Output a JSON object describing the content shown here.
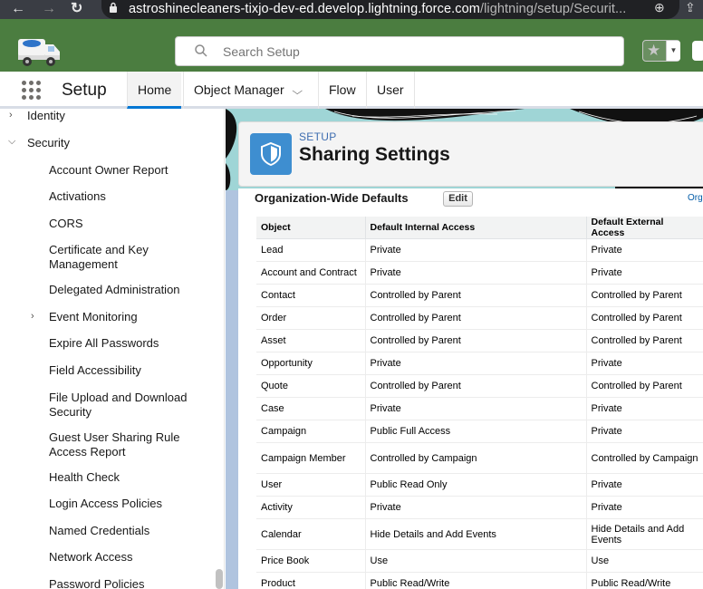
{
  "browser": {
    "back_glyph": "←",
    "forward_glyph": "→",
    "reload_glyph": "↻",
    "url_host": "astroshinecleaners-tixjo-dev-ed.develop.lightning.force.com",
    "url_path": "/lightning/setup/Securit...",
    "zoom_glyph": "⊕",
    "share_glyph": "⇪"
  },
  "header": {
    "search_placeholder": "Search Setup",
    "favorites_star": "★",
    "favorites_dropdown": "▼"
  },
  "appnav": {
    "app_name": "Setup",
    "tabs": [
      {
        "label": "Home",
        "active": true
      },
      {
        "label": "Object Manager",
        "has_menu": true
      },
      {
        "label": "Flow"
      },
      {
        "label": "User"
      }
    ],
    "chevron": "⌵"
  },
  "sidebar": {
    "items": [
      {
        "label": "Identity",
        "arrow": "›",
        "level": 0
      },
      {
        "label": "Security",
        "arrow": "⌵",
        "level": 0
      },
      {
        "label": "Account Owner Report"
      },
      {
        "label": "Activations"
      },
      {
        "label": "CORS"
      },
      {
        "label": "Certificate and Key Management"
      },
      {
        "label": "Delegated Administration"
      },
      {
        "label": "Event Monitoring",
        "arrow": "›"
      },
      {
        "label": "Expire All Passwords"
      },
      {
        "label": "Field Accessibility"
      },
      {
        "label": "File Upload and Download Security"
      },
      {
        "label": "Guest User Sharing Rule Access Report"
      },
      {
        "label": "Health Check"
      },
      {
        "label": "Login Access Policies"
      },
      {
        "label": "Named Credentials"
      },
      {
        "label": "Network Access"
      },
      {
        "label": "Password Policies"
      }
    ]
  },
  "page_header": {
    "eyebrow": "SETUP",
    "title": "Sharing Settings"
  },
  "owd": {
    "title": "Organization-Wide Defaults",
    "edit_label": "Edit",
    "org_link": "Org",
    "columns": [
      "Object",
      "Default Internal Access",
      "Default External Access"
    ],
    "rows": [
      [
        "Lead",
        "Private",
        "Private"
      ],
      [
        "Account and Contract",
        "Private",
        "Private"
      ],
      [
        "Contact",
        "Controlled by Parent",
        "Controlled by Parent"
      ],
      [
        "Order",
        "Controlled by Parent",
        "Controlled by Parent"
      ],
      [
        "Asset",
        "Controlled by Parent",
        "Controlled by Parent"
      ],
      [
        "Opportunity",
        "Private",
        "Private"
      ],
      [
        "Quote",
        "Controlled by Parent",
        "Controlled by Parent"
      ],
      [
        "Case",
        "Private",
        "Private"
      ],
      [
        "Campaign",
        "Public Full Access",
        "Private"
      ],
      [
        "Campaign Member",
        "Controlled by Campaign",
        "Controlled by Campaign"
      ],
      [
        "User",
        "Public Read Only",
        "Private"
      ],
      [
        "Activity",
        "Private",
        "Private"
      ],
      [
        "Calendar",
        "Hide Details and Add Events",
        "Hide Details and Add Events"
      ],
      [
        "Price Book",
        "Use",
        "Use"
      ],
      [
        "Product",
        "Public Read/Write",
        "Public Read/Write"
      ]
    ]
  },
  "colors": {
    "header_green": "#4b7d40",
    "active_tab_underline": "#0176d3",
    "header_icon_blue": "#3e8ed0"
  }
}
